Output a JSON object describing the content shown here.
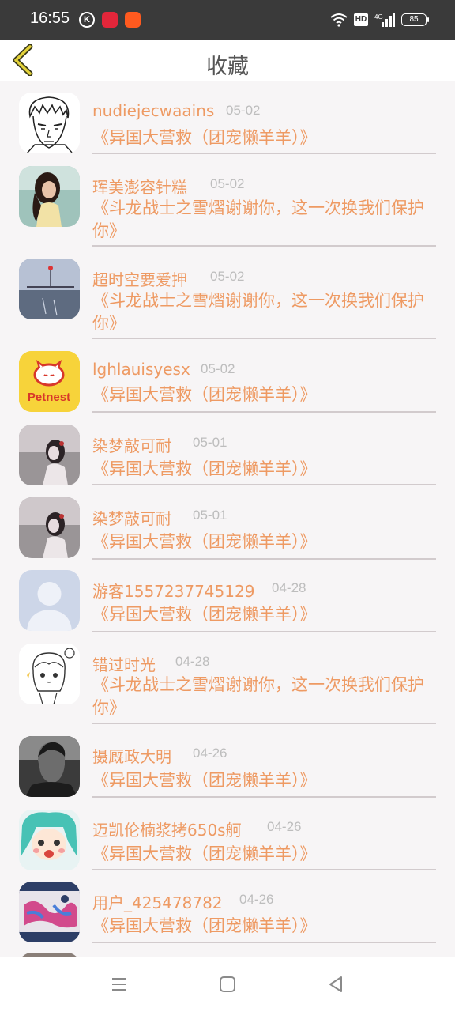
{
  "status_bar": {
    "time": "16:55",
    "left_icons": [
      "k-icon",
      "app-icon-red",
      "app-icon-orange"
    ],
    "hd_label": "HD",
    "network_label": "4G",
    "battery": "85"
  },
  "header": {
    "title": "收藏",
    "back_icon": "chevron-left-icon"
  },
  "favorites": [
    {
      "user": "nudiejecwaains",
      "date": "05-02",
      "text": "《异国大营救（团宠懒羊羊）》",
      "avatar": "anime-sketch"
    },
    {
      "user": "珲美澎容针糕",
      "date": "05-02",
      "text": "《斗龙战士之雪熠谢谢你，这一次换我们保护你》",
      "avatar": "girl-photo"
    },
    {
      "user": "超时空要爱押",
      "date": "05-02",
      "text": "《斗龙战士之雪熠谢谢你，这一次换我们保护你》",
      "avatar": "lake-scene"
    },
    {
      "user": "lghlauisyesx",
      "date": "05-02",
      "text": "《异国大营救（团宠懒羊羊）》",
      "avatar": "petnest-logo"
    },
    {
      "user": "染梦敲可耐",
      "date": "05-01",
      "text": "《异国大营救（团宠懒羊羊）》",
      "avatar": "girl-bw"
    },
    {
      "user": "染梦敲可耐",
      "date": "05-01",
      "text": "《异国大营救（团宠懒羊羊）》",
      "avatar": "girl-bw"
    },
    {
      "user": "游客1557237745129",
      "date": "04-28",
      "text": "《异国大营救（团宠懒羊羊）》",
      "avatar": "default-person"
    },
    {
      "user": "错过时光",
      "date": "04-28",
      "text": "《斗龙战士之雪熠谢谢你，这一次换我们保护你》",
      "avatar": "anime-chibi"
    },
    {
      "user": "摄厩政大明",
      "date": "04-26",
      "text": "《异国大营救（团宠懒羊羊）》",
      "avatar": "man-bw"
    },
    {
      "user": "迈凯伦楠浆拷650s舸",
      "date": "04-26",
      "text": "《异国大营救（团宠懒羊羊）》",
      "avatar": "miku"
    },
    {
      "user": "用户_425478782",
      "date": "04-26",
      "text": "《异国大营救（团宠懒羊羊）》",
      "avatar": "colorful-art"
    }
  ],
  "petnest_logo_text": "Petnest",
  "nav": {
    "menu_icon": "menu-icon",
    "home_icon": "home-square-icon",
    "back_icon": "back-triangle-icon"
  }
}
